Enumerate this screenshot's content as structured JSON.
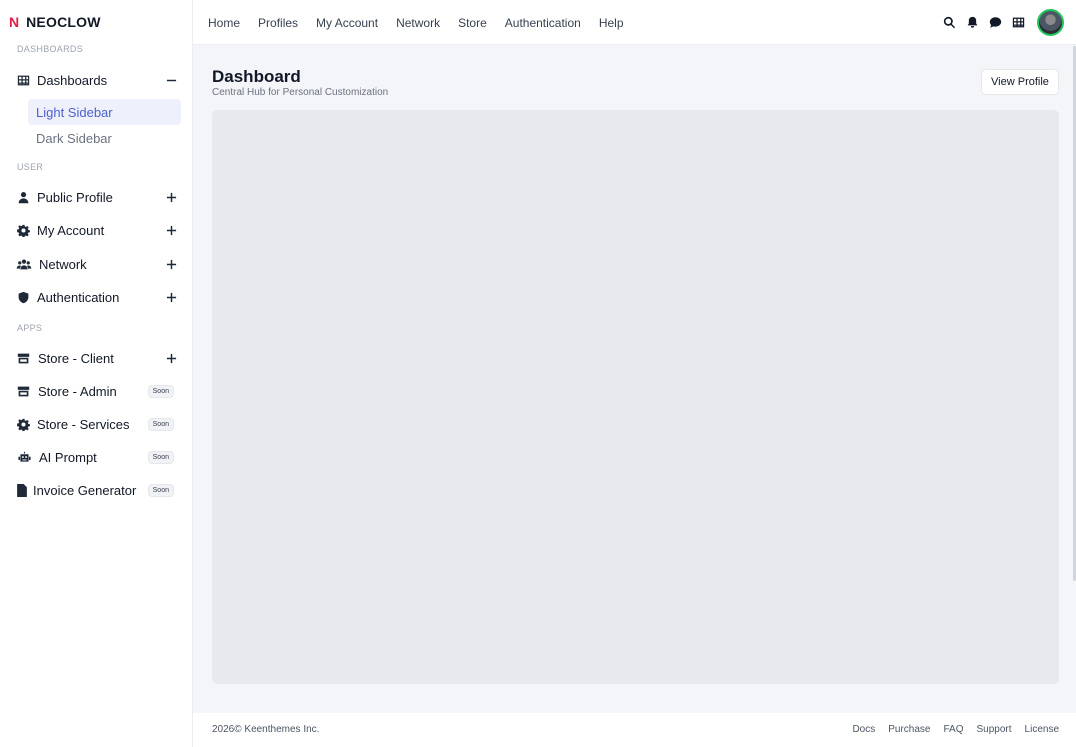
{
  "brand": {
    "logo": "N",
    "name": "NEOCLOW"
  },
  "sidebar": {
    "sections": {
      "dashboards": "DASHBOARDS",
      "user": "USER",
      "apps": "APPS"
    },
    "dashboards": {
      "label": "Dashboards",
      "icon": "table-grid-icon",
      "sub": [
        "Light Sidebar",
        "Dark Sidebar"
      ],
      "active_sub": "Light Sidebar"
    },
    "user_items": [
      {
        "label": "Public Profile",
        "icon": "user-icon"
      },
      {
        "label": "My Account",
        "icon": "gear-icon"
      },
      {
        "label": "Network",
        "icon": "users-icon"
      },
      {
        "label": "Authentication",
        "icon": "shield-icon"
      }
    ],
    "app_items": [
      {
        "label": "Store - Client",
        "icon": "store-icon"
      },
      {
        "label": "Store - Admin",
        "icon": "store-icon",
        "badge": "Soon"
      },
      {
        "label": "Store - Services",
        "icon": "gear-icon",
        "badge": "Soon"
      },
      {
        "label": "AI Prompt",
        "icon": "robot-icon",
        "badge": "Soon"
      },
      {
        "label": "Invoice Generator",
        "icon": "file-icon",
        "badge": "Soon"
      }
    ]
  },
  "topnav": [
    "Home",
    "Profiles",
    "My Account",
    "Network",
    "Store",
    "Authentication",
    "Help"
  ],
  "toolbar_icons": [
    "search-icon",
    "bell-icon",
    "chat-icon",
    "apps-grid-icon",
    "avatar"
  ],
  "main": {
    "title": "Dashboard",
    "subtitle": "Central Hub for Personal Customization",
    "view_profile": "View Profile"
  },
  "footer": {
    "copyright": "2026© Keenthemes Inc.",
    "links": [
      "Docs",
      "Purchase",
      "FAQ",
      "Support",
      "License"
    ]
  },
  "colors": {
    "accent": "#4f5fd0",
    "active_bg": "#eef1fb",
    "brand_logo": "#e11d48",
    "avatar_ring": "#22c55e"
  }
}
